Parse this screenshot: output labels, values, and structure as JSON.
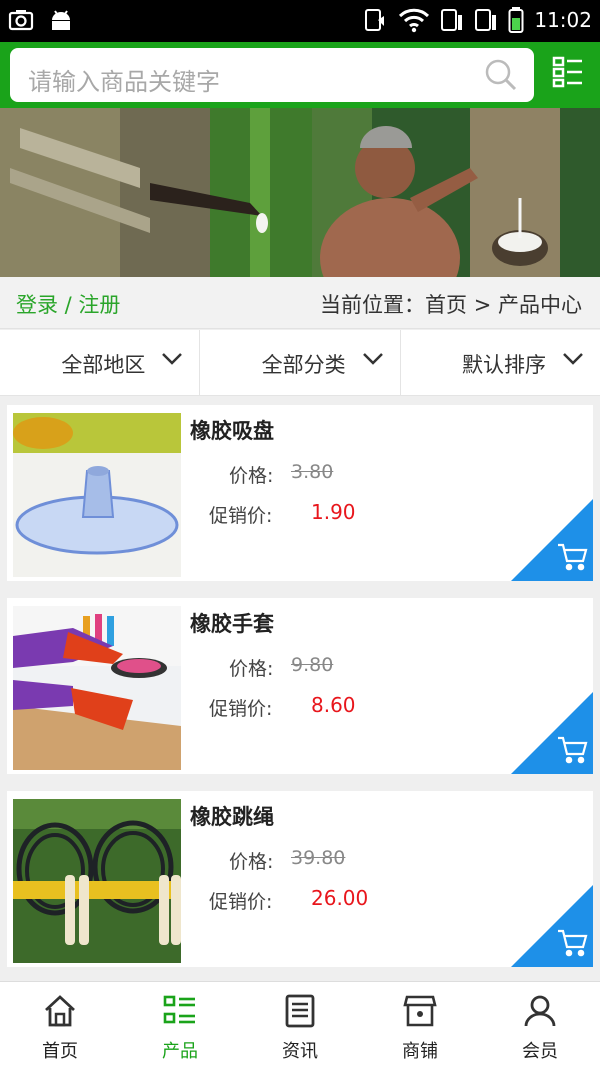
{
  "status_bar": {
    "time": "11:02"
  },
  "search": {
    "placeholder": "请输入商品关键字"
  },
  "breadcrumb": {
    "login_label": "登录 / 注册",
    "location_prefix": "当前位置：",
    "path": "首页 > 产品中心"
  },
  "filters": [
    {
      "label": "全部地区"
    },
    {
      "label": "全部分类"
    },
    {
      "label": "默认排序"
    }
  ],
  "products": [
    {
      "name": "橡胶吸盘",
      "price_label": "价格:",
      "price": "3.80",
      "promo_label": "促销价:",
      "promo": "1.90"
    },
    {
      "name": "橡胶手套",
      "price_label": "价格:",
      "price": "9.80",
      "promo_label": "促销价:",
      "promo": "8.60"
    },
    {
      "name": "橡胶跳绳",
      "price_label": "价格:",
      "price": "39.80",
      "promo_label": "促销价:",
      "promo": "26.00"
    }
  ],
  "tabs": [
    {
      "label": "首页",
      "icon": "home-icon"
    },
    {
      "label": "产品",
      "icon": "product-grid-icon"
    },
    {
      "label": "资讯",
      "icon": "news-icon"
    },
    {
      "label": "商铺",
      "icon": "store-icon"
    },
    {
      "label": "会员",
      "icon": "user-icon"
    }
  ],
  "colors": {
    "brand": "#1aa31a",
    "promo": "#e8161c",
    "cart": "#1e90e8"
  }
}
